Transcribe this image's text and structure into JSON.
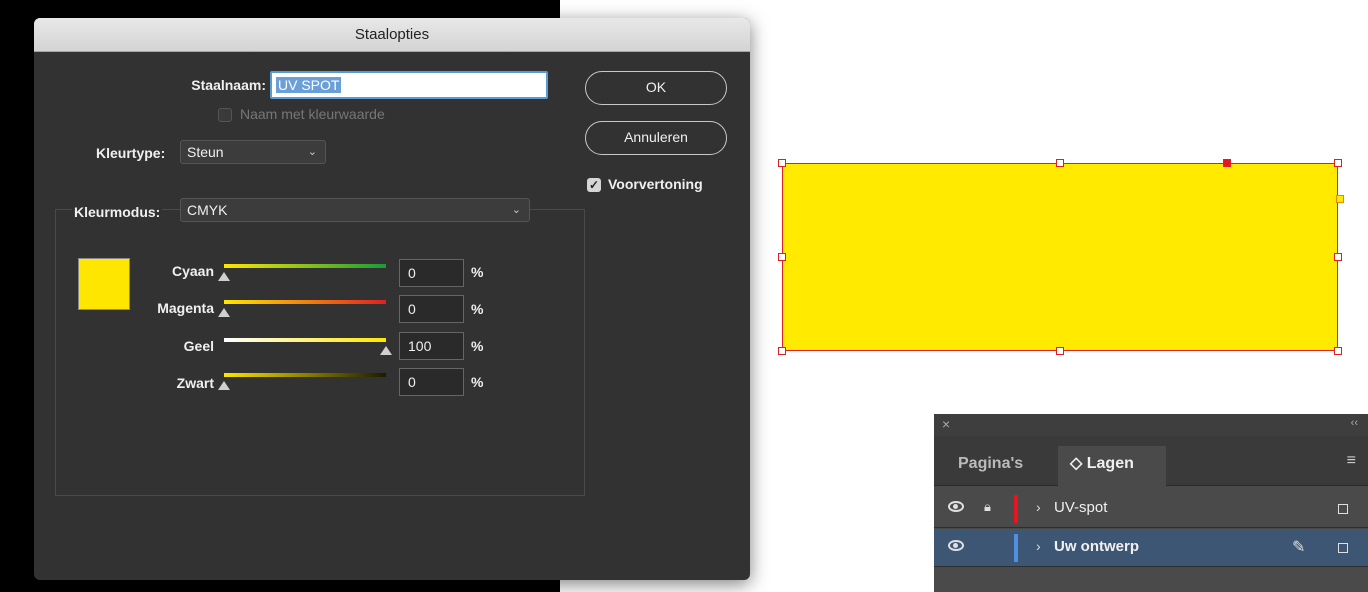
{
  "dialog": {
    "title": "Staalopties",
    "name_label": "Staalnaam:",
    "name_value": "UV SPOT",
    "name_with_value_label": "Naam met kleurwaarde",
    "color_type_label": "Kleurtype:",
    "color_type_value": "Steun",
    "color_mode_label": "Kleurmodus:",
    "color_mode_value": "CMYK",
    "ok_label": "OK",
    "cancel_label": "Annuleren",
    "preview_label": "Voorvertoning",
    "sliders": [
      {
        "label": "Cyaan",
        "value": "0",
        "unit": "%",
        "fraction": 0
      },
      {
        "label": "Magenta",
        "value": "0",
        "unit": "%",
        "fraction": 0
      },
      {
        "label": "Geel",
        "value": "100",
        "unit": "%",
        "fraction": 1
      },
      {
        "label": "Zwart",
        "value": "0",
        "unit": "%",
        "fraction": 0
      }
    ],
    "swatch_color": "#ffe600"
  },
  "canvas": {
    "rect_color": "#ffea00",
    "frame_color": "#e02020"
  },
  "layers_panel": {
    "close": "×",
    "collapse": "‹‹",
    "tab_pages": "Pagina's",
    "tab_layers": "◇ Lagen",
    "menu": "≡",
    "layers": [
      {
        "name": "UV-spot",
        "color": "#e8141e",
        "locked": true,
        "selected": false
      },
      {
        "name": "Uw ontwerp",
        "color": "#4f8fe0",
        "locked": false,
        "selected": true
      }
    ]
  }
}
